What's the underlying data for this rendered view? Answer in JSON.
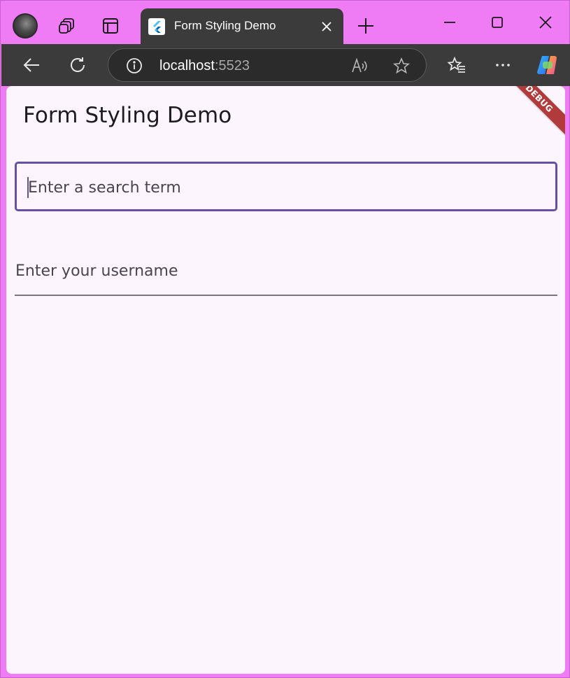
{
  "browser": {
    "tab": {
      "title": "Form Styling Demo"
    },
    "address": {
      "host": "localhost",
      "port": ":5523"
    },
    "icons": {
      "profile": "profile-avatar",
      "workspaces": "workspaces-icon",
      "tab_actions": "tab-actions-icon",
      "favicon": "flutter-icon",
      "close_tab": "close-icon",
      "new_tab": "plus-icon",
      "minimize": "minimize-icon",
      "maximize": "maximize-icon",
      "close_window": "close-icon",
      "back": "back-arrow-icon",
      "refresh": "refresh-icon",
      "site_info": "info-icon",
      "read_aloud": "read-aloud-icon",
      "favorite": "star-icon",
      "favorites_list": "favorites-icon",
      "more": "more-icon",
      "copilot": "copilot-icon"
    },
    "colors": {
      "frame": "#f07cf5",
      "toolbar": "#3b3b3b"
    }
  },
  "app": {
    "title": "Form Styling Demo",
    "search": {
      "placeholder": "Enter a search term"
    },
    "username": {
      "label": "Enter your username"
    },
    "debug_banner": "DEBUG",
    "colors": {
      "background": "#fdf5fd",
      "accent": "#6750a4",
      "banner": "#b13b3b"
    }
  }
}
